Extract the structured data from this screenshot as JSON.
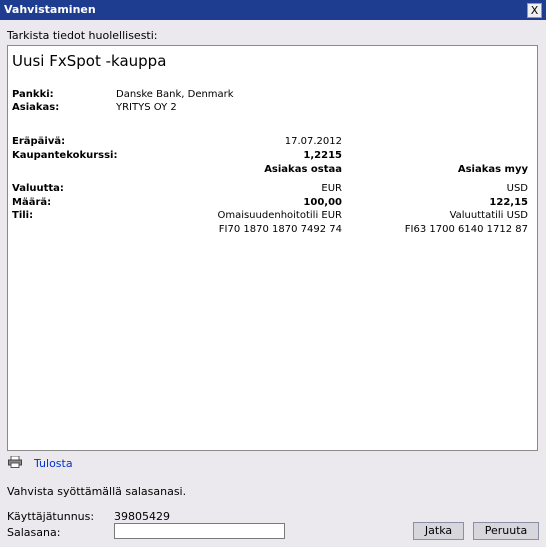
{
  "window": {
    "title": "Vahvistaminen",
    "close_symbol": "X"
  },
  "instruction": "Tarkista tiedot huolellisesti:",
  "trade": {
    "heading": "Uusi FxSpot -kauppa",
    "bank_label": "Pankki:",
    "bank_value": "Danske Bank, Denmark",
    "customer_label": "Asiakas:",
    "customer_value": "YRITYS OY 2",
    "due_label": "Eräpäivä:",
    "due_value": "17.07.2012",
    "rate_label": "Kaupantekokurssi:",
    "rate_value": "1,2215",
    "buy_header": "Asiakas ostaa",
    "sell_header": "Asiakas myy",
    "currency_label": "Valuutta:",
    "buy_currency": "EUR",
    "sell_currency": "USD",
    "amount_label": "Määrä:",
    "buy_amount": "100,00",
    "sell_amount": "122,15",
    "account_label": "Tili:",
    "buy_account_name": "Omaisuudenhoitotili EUR",
    "sell_account_name": "Valuuttatili USD",
    "buy_account_no": "FI70 1870 1870 7492 74",
    "sell_account_no": "FI63 1700 6140 1712 87"
  },
  "print": {
    "icon": "printer-icon",
    "label": "Tulosta"
  },
  "confirm_text": "Vahvista syöttämällä salasanasi.",
  "user": {
    "label": "Käyttäjätunnus:",
    "value": "39805429"
  },
  "password": {
    "label": "Salasana:",
    "value": ""
  },
  "buttons": {
    "continue": "Jatka",
    "cancel": "Peruuta"
  }
}
